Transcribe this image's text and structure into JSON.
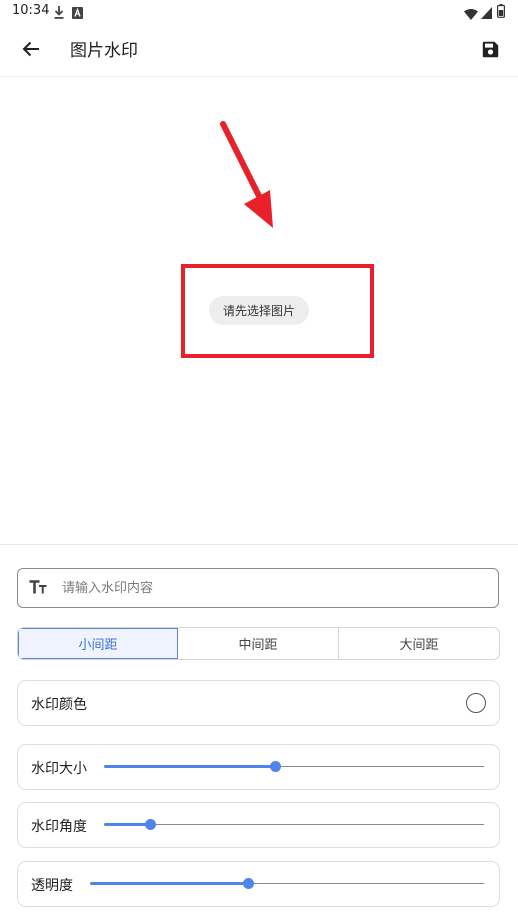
{
  "status_bar": {
    "time": "10:34",
    "icons": [
      "download-icon",
      "font-icon",
      "wifi-icon",
      "signal-icon",
      "battery-icon"
    ]
  },
  "app_bar": {
    "title": "图片水印",
    "back_icon": "arrow-left-icon",
    "save_icon": "floppy-disk-icon"
  },
  "preview": {
    "select_image_label": "请先选择图片",
    "annotation_color": "#e8202a"
  },
  "watermark_input": {
    "icon": "text-size-icon",
    "placeholder": "请输入水印内容",
    "value": ""
  },
  "spacing": {
    "options": [
      "小间距",
      "中间距",
      "大间距"
    ],
    "selected": "小间距"
  },
  "settings": {
    "color": {
      "label": "水印颜色"
    },
    "size": {
      "label": "水印大小",
      "value": 0.45
    },
    "angle": {
      "label": "水印角度",
      "value": 0.12
    },
    "opacity": {
      "label": "透明度",
      "value": 0.4
    }
  },
  "accent_color": "#4f85ea"
}
